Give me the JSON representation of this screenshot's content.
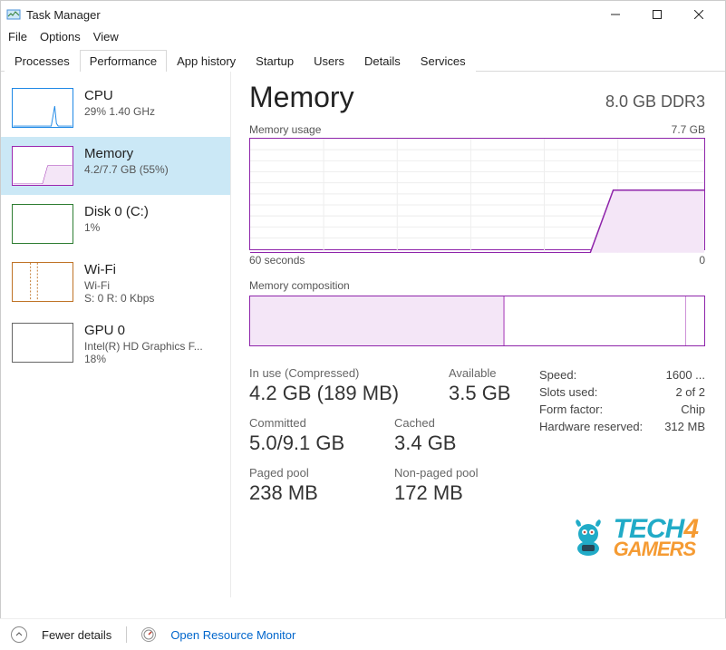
{
  "window": {
    "title": "Task Manager"
  },
  "menu": [
    "File",
    "Options",
    "View"
  ],
  "tabs": [
    "Processes",
    "Performance",
    "App history",
    "Startup",
    "Users",
    "Details",
    "Services"
  ],
  "active_tab": "Performance",
  "sidebar": [
    {
      "name": "CPU",
      "sub": "29%  1.40 GHz",
      "sub2": ""
    },
    {
      "name": "Memory",
      "sub": "4.2/7.7 GB (55%)",
      "sub2": ""
    },
    {
      "name": "Disk 0 (C:)",
      "sub": "1%",
      "sub2": ""
    },
    {
      "name": "Wi-Fi",
      "sub": "Wi-Fi",
      "sub2": "S: 0  R: 0 Kbps"
    },
    {
      "name": "GPU 0",
      "sub": "Intel(R) HD Graphics F...",
      "sub2": "18%"
    }
  ],
  "selected_sidebar": 1,
  "main": {
    "title": "Memory",
    "capacity": "8.0 GB DDR3",
    "graph_label_left": "Memory usage",
    "graph_label_right": "7.7 GB",
    "axis_left": "60 seconds",
    "axis_right": "0",
    "composition_label": "Memory composition",
    "stats": {
      "in_use_label": "In use (Compressed)",
      "in_use_value": "4.2 GB (189 MB)",
      "available_label": "Available",
      "available_value": "3.5 GB",
      "committed_label": "Committed",
      "committed_value": "5.0/9.1 GB",
      "cached_label": "Cached",
      "cached_value": "3.4 GB",
      "paged_label": "Paged pool",
      "paged_value": "238 MB",
      "nonpaged_label": "Non-paged pool",
      "nonpaged_value": "172 MB"
    },
    "specs": {
      "speed_label": "Speed:",
      "speed_value": "1600 ...",
      "slots_label": "Slots used:",
      "slots_value": "2 of 2",
      "form_label": "Form factor:",
      "form_value": "Chip",
      "hw_label": "Hardware reserved:",
      "hw_value": "312 MB"
    }
  },
  "footer": {
    "fewer": "Fewer details",
    "resmon": "Open Resource Monitor"
  },
  "chart_data": {
    "type": "line",
    "title": "Memory usage",
    "xlabel": "60 seconds → 0",
    "ylabel": "GB",
    "ylim": [
      0,
      7.7
    ],
    "x": [
      60,
      50,
      40,
      30,
      20,
      15,
      10,
      5,
      0
    ],
    "values": [
      0,
      0,
      0,
      0,
      0,
      0,
      4.2,
      4.2,
      4.2
    ],
    "annotations": [
      "memory jumps to ~4.2 GB near right side and holds"
    ]
  },
  "watermark": {
    "line1": "TECH",
    "line2": "GAMERS",
    "four": "4"
  }
}
